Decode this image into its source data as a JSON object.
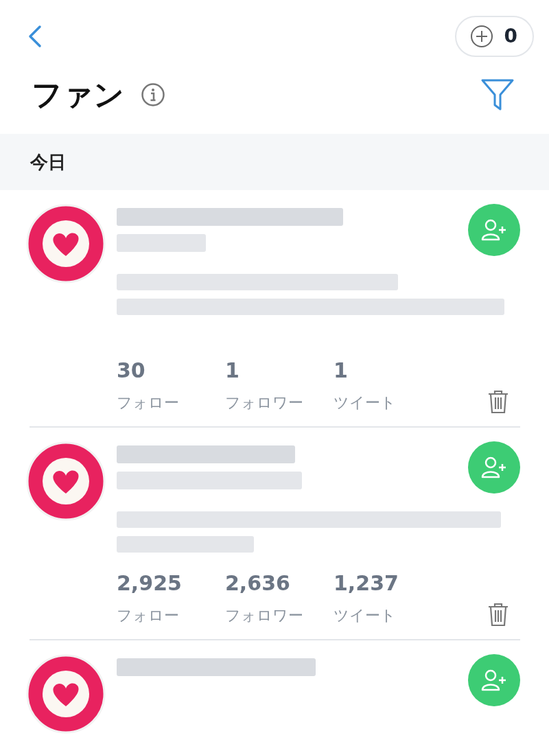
{
  "header": {
    "counter": "0"
  },
  "title": "ファン",
  "section": "今日",
  "fans": [
    {
      "kind": "full",
      "stats": [
        {
          "value": "30",
          "label": "フォロー"
        },
        {
          "value": "1",
          "label": "フォロワー"
        },
        {
          "value": "1",
          "label": "ツイート"
        }
      ]
    },
    {
      "kind": "full",
      "stats": [
        {
          "value": "2,925",
          "label": "フォロー"
        },
        {
          "value": "2,636",
          "label": "フォロワー"
        },
        {
          "value": "1,237",
          "label": "ツイート"
        }
      ]
    },
    {
      "kind": "partial"
    }
  ]
}
